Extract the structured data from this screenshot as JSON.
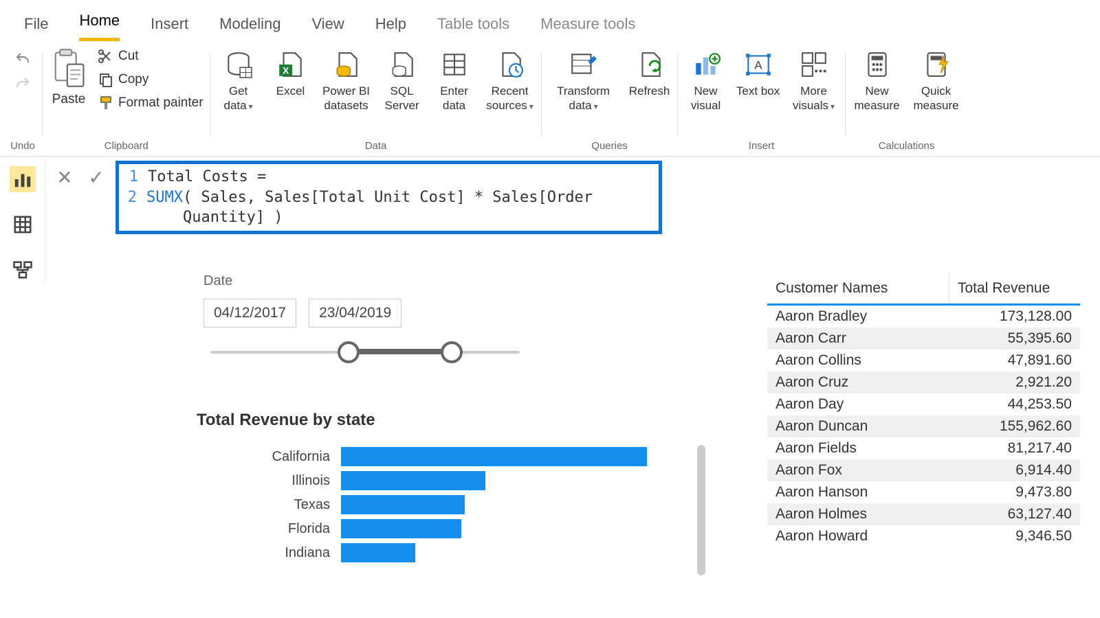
{
  "menu": {
    "file": "File",
    "home": "Home",
    "insert": "Insert",
    "modeling": "Modeling",
    "view": "View",
    "help": "Help",
    "table_tools": "Table tools",
    "measure_tools": "Measure tools"
  },
  "ribbon": {
    "undo_group": "Undo",
    "clipboard_group": "Clipboard",
    "paste": "Paste",
    "cut": "Cut",
    "copy": "Copy",
    "format_painter": "Format painter",
    "data_group": "Data",
    "get_data": "Get data",
    "excel": "Excel",
    "pbi_datasets": "Power BI datasets",
    "sql_server": "SQL Server",
    "enter_data": "Enter data",
    "recent_sources": "Recent sources",
    "queries_group": "Queries",
    "transform_data": "Transform data",
    "refresh": "Refresh",
    "insert_group": "Insert",
    "new_visual": "New visual",
    "text_box": "Text box",
    "more_visuals": "More visuals",
    "calc_group": "Calculations",
    "new_measure": "New measure",
    "quick_measure": "Quick measure"
  },
  "formula": {
    "line1": "Total Costs =",
    "kw": "SUMX",
    "rest": "( Sales, Sales[Total Unit Cost] * Sales[Order Quantity] )"
  },
  "slicer": {
    "title": "Date",
    "start": "04/12/2017",
    "end": "23/04/2019"
  },
  "chart_data": {
    "type": "bar",
    "title": "Total Revenue by state",
    "xlabel": "",
    "ylabel": "",
    "categories": [
      "California",
      "Illinois",
      "Texas",
      "Florida",
      "Indiana"
    ],
    "values": [
      100,
      47,
      40,
      39,
      24
    ]
  },
  "rev_table": {
    "headers": {
      "name": "Customer Names",
      "rev": "Total Revenue"
    },
    "rows": [
      {
        "name": "Aaron Bradley",
        "rev": "173,128.00"
      },
      {
        "name": "Aaron Carr",
        "rev": "55,395.60"
      },
      {
        "name": "Aaron Collins",
        "rev": "47,891.60"
      },
      {
        "name": "Aaron Cruz",
        "rev": "2,921.20"
      },
      {
        "name": "Aaron Day",
        "rev": "44,253.50"
      },
      {
        "name": "Aaron Duncan",
        "rev": "155,962.60"
      },
      {
        "name": "Aaron Fields",
        "rev": "81,217.40"
      },
      {
        "name": "Aaron Fox",
        "rev": "6,914.40"
      },
      {
        "name": "Aaron Hanson",
        "rev": "9,473.80"
      },
      {
        "name": "Aaron Holmes",
        "rev": "63,127.40"
      },
      {
        "name": "Aaron Howard",
        "rev": "9,346.50"
      }
    ]
  }
}
